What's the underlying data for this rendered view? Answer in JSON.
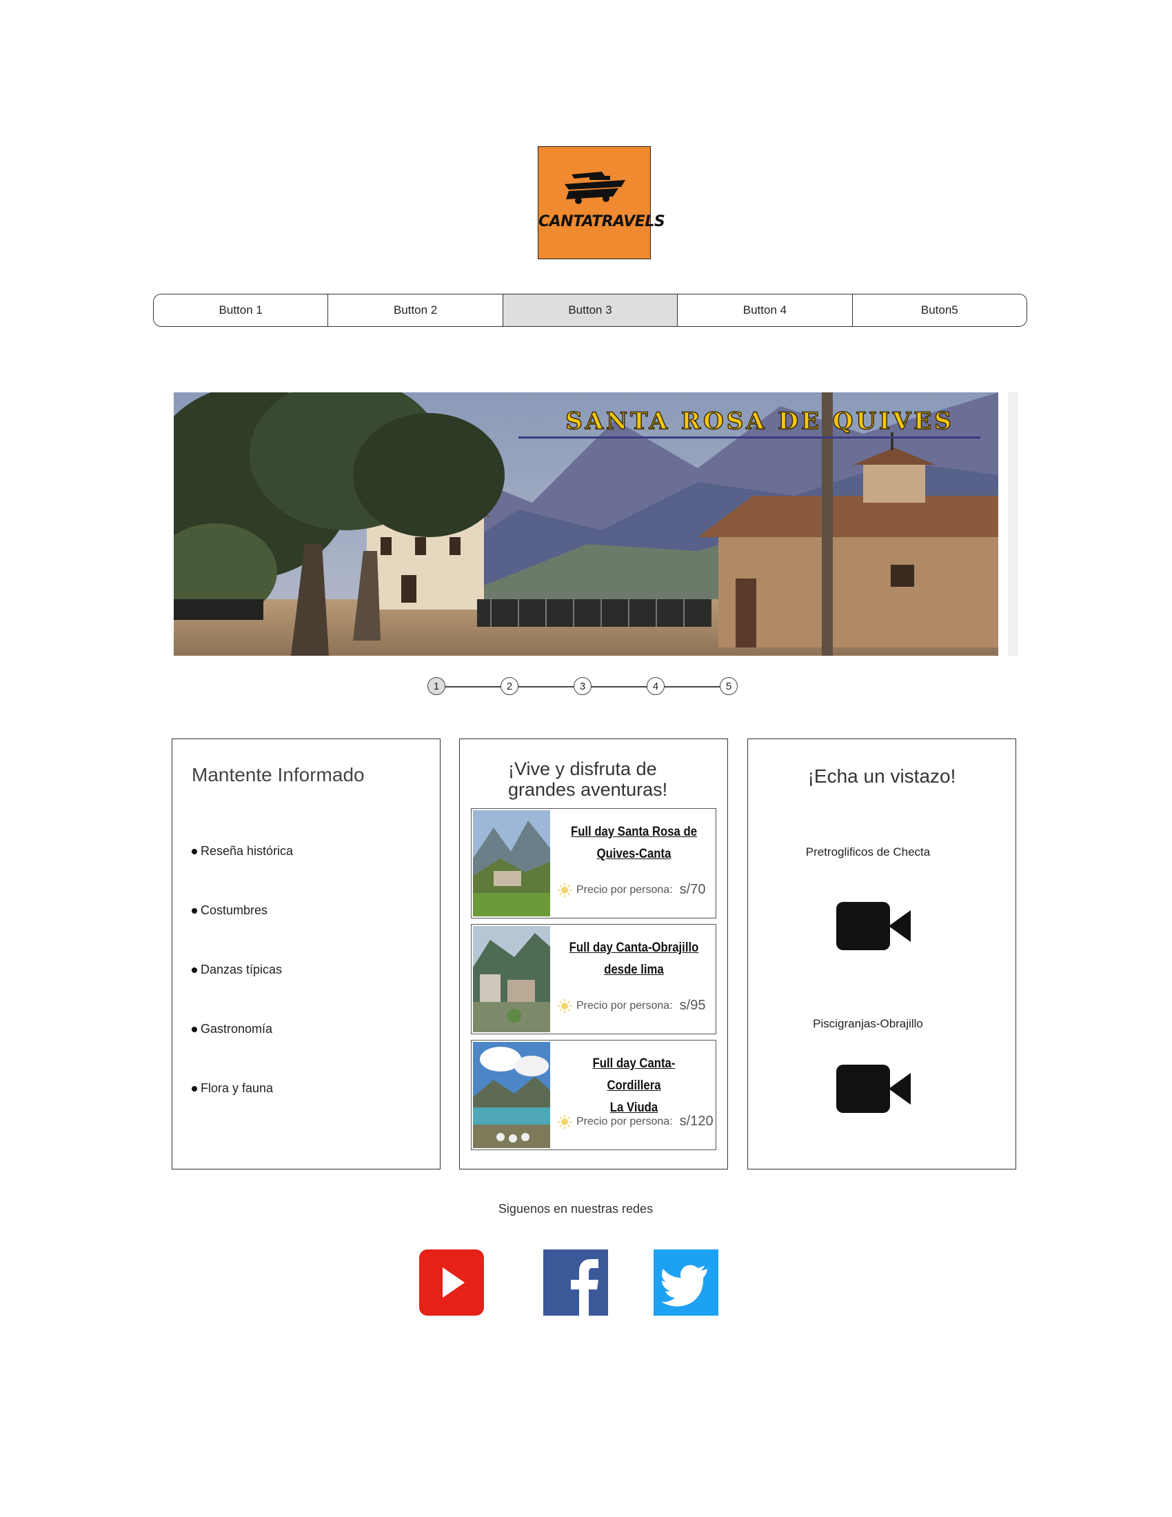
{
  "logo": {
    "text": "CANTATRAVELS",
    "brand_color": "#f08a30"
  },
  "nav": {
    "items": [
      {
        "label": "Button 1"
      },
      {
        "label": "Button 2"
      },
      {
        "label": "Button 3",
        "active": true
      },
      {
        "label": "Button 4"
      },
      {
        "label": "Buton5"
      }
    ]
  },
  "hero": {
    "title": "SANTA ROSA DE QUIVES",
    "title_color": "#f3c614"
  },
  "stepper": {
    "steps": [
      "1",
      "2",
      "3",
      "4",
      "5"
    ],
    "active_step": "1"
  },
  "info_panel": {
    "title": "Mantente Informado",
    "items": [
      "Reseña histórica",
      "Costumbres",
      "Danzas típicas",
      "Gastronomía",
      "Flora y fauna"
    ]
  },
  "tours_panel": {
    "title_line1": "¡Vive y disfruta de",
    "title_line2": "grandes aventuras!",
    "price_label": "Precio por persona:",
    "tours": [
      {
        "name_line1": "Full day Santa Rosa de",
        "name_line2": "Quives-Canta",
        "price": "s/70"
      },
      {
        "name_line1": "Full day Canta-Obrajillo",
        "name_line2": "desde lima",
        "price": "s/95"
      },
      {
        "name_line1": "Full day Canta-Cordillera",
        "name_line2": "La Viuda",
        "price": "s/120"
      }
    ]
  },
  "videos_panel": {
    "title": "¡Echa un vistazo!",
    "videos": [
      {
        "label": "Pretroglificos de Checta",
        "icon": "video-camera-icon"
      },
      {
        "label": "Piscigranjas-Obrajillo",
        "icon": "video-camera-icon"
      }
    ]
  },
  "social": {
    "label": "Siguenos en nuestras redes",
    "networks": [
      {
        "icon": "youtube-icon",
        "color": "#e62117"
      },
      {
        "icon": "facebook-icon",
        "color": "#3b5998"
      },
      {
        "icon": "twitter-icon",
        "color": "#1da1f2"
      }
    ]
  }
}
